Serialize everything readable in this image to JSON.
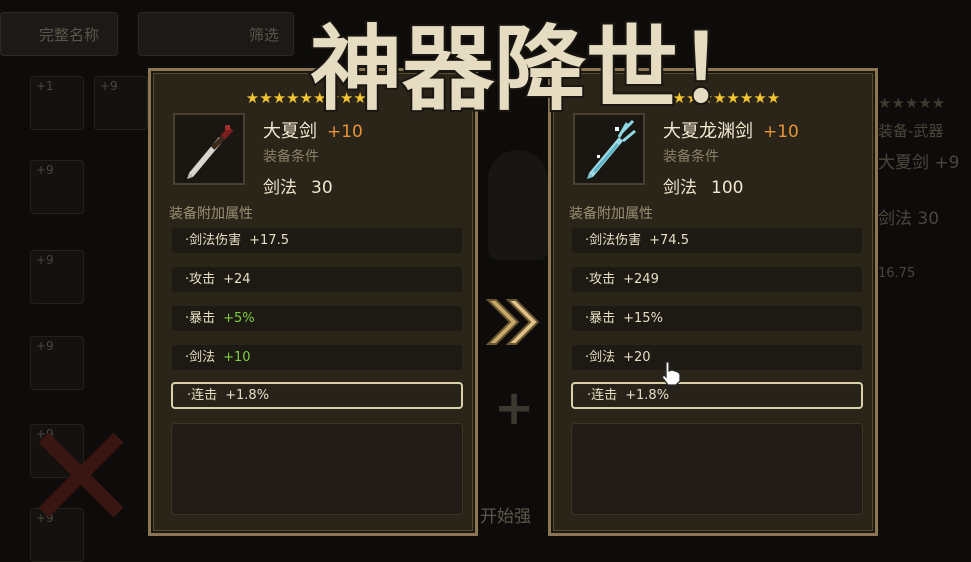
{
  "title": "神器降世！",
  "background": {
    "tabs": [
      "完整名称",
      "筛选"
    ],
    "slot_levels": [
      "+1",
      "+9",
      "+9",
      "+9",
      "+9",
      "+9",
      "+9"
    ],
    "right_panel": {
      "category": "装备-武器",
      "name": "大夏剑 +9",
      "skill": "剑法 30",
      "value": "16.75"
    },
    "start_label": "开始强",
    "plus_sign": "+"
  },
  "left_item": {
    "stars": "★★★★★★★★★★",
    "star_count": 10,
    "name": "大夏剑",
    "plus": "+10",
    "cond_label": "装备条件",
    "skill_name": "剑法",
    "skill_value": "30",
    "attr_title": "装备附加属性",
    "icon": "sword-icon",
    "attrs": [
      {
        "label": "·剑法伤害",
        "value": "+17.5",
        "color": "normal"
      },
      {
        "label": "·攻击",
        "value": "+24",
        "color": "normal"
      },
      {
        "label": "·暴击",
        "value": "+5%",
        "color": "green"
      },
      {
        "label": "·剑法",
        "value": "+10",
        "color": "green"
      },
      {
        "label": "·连击",
        "value": "+1.8%",
        "color": "normal",
        "selected": true
      }
    ]
  },
  "right_item": {
    "stars": "★★★★★★★★★★",
    "star_count": 10,
    "name": "大夏龙渊剑",
    "plus": "+10",
    "cond_label": "装备条件",
    "skill_name": "剑法",
    "skill_value": "100",
    "attr_title": "装备附加属性",
    "icon": "dragon-sword-icon",
    "attrs": [
      {
        "label": "·剑法伤害",
        "value": "+74.5",
        "color": "normal"
      },
      {
        "label": "·攻击",
        "value": "+249",
        "color": "normal"
      },
      {
        "label": "·暴击",
        "value": "+15%",
        "color": "normal"
      },
      {
        "label": "·剑法",
        "value": "+20",
        "color": "normal"
      },
      {
        "label": "·连击",
        "value": "+1.8%",
        "color": "normal",
        "selected": true
      }
    ]
  },
  "colors": {
    "accent_plus": "#e6943a",
    "stat_green": "#7ecf3c",
    "star": "#f2c531",
    "panel_border": "#8a7652"
  }
}
